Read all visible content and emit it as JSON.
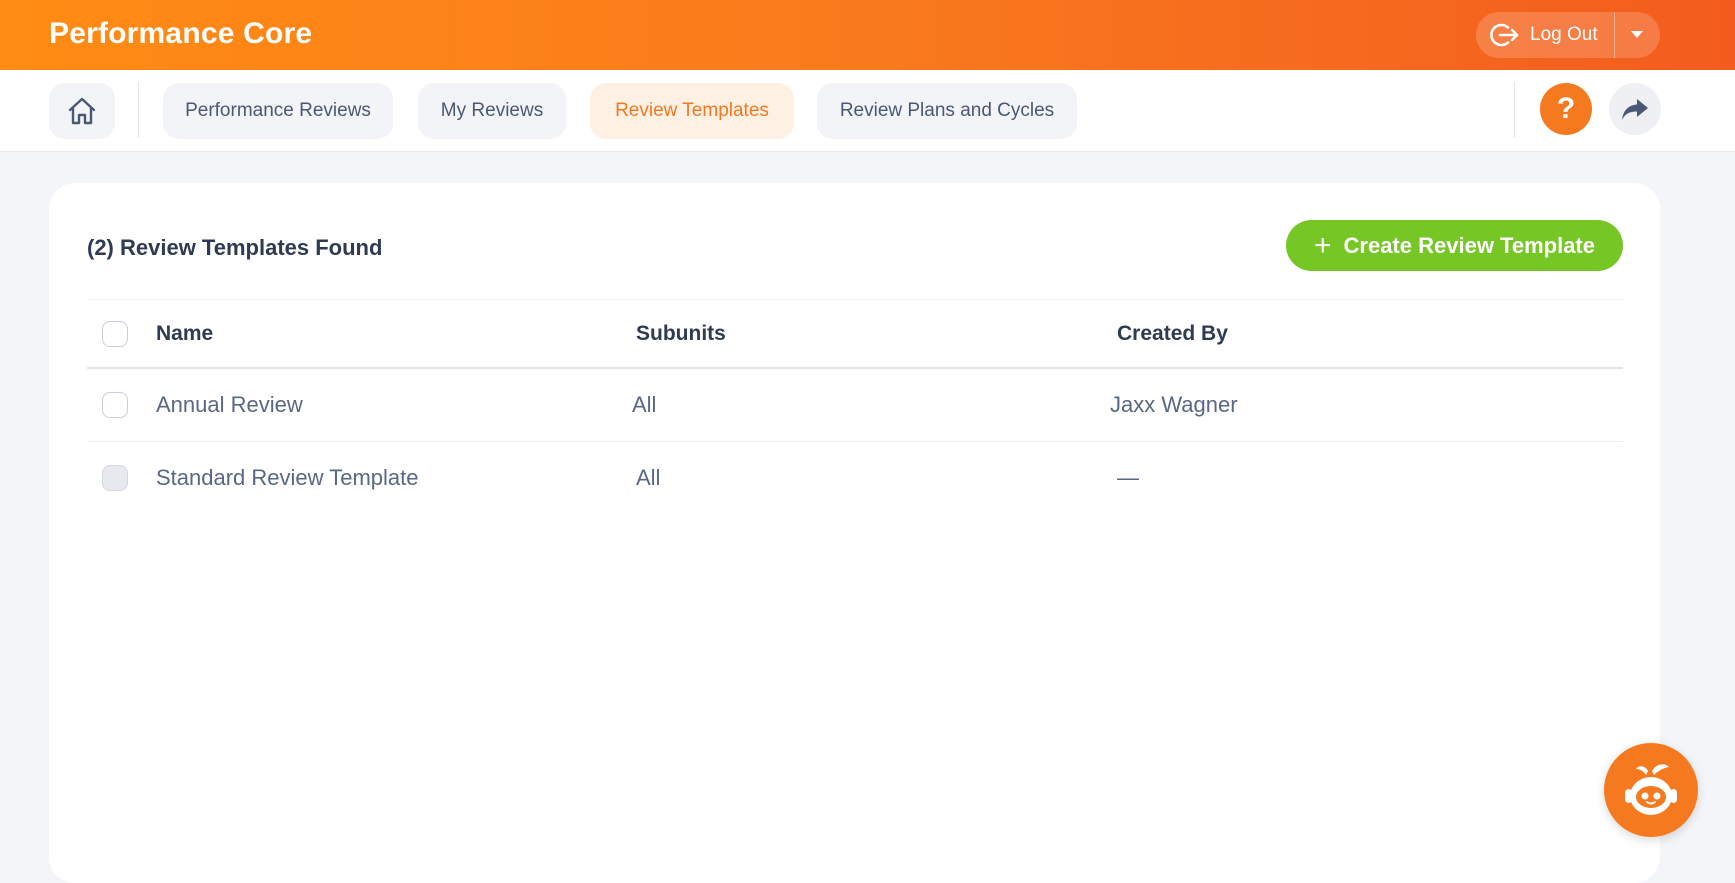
{
  "app": {
    "title": "Performance Core"
  },
  "header": {
    "logout_label": "Log Out",
    "logout_icon": "logout-icon",
    "dropdown_icon": "caret-down-icon"
  },
  "nav": {
    "home_icon": "home-icon",
    "tabs": [
      {
        "label": "Performance Reviews",
        "active": false
      },
      {
        "label": "My Reviews",
        "active": false
      },
      {
        "label": "Review Templates",
        "active": true
      },
      {
        "label": "Review Plans and Cycles",
        "active": false
      }
    ],
    "help_label": "?",
    "share_icon": "share-icon"
  },
  "main": {
    "count_label": "(2) Review Templates Found",
    "create_button": {
      "icon": "+",
      "label": "Create Review Template"
    },
    "table": {
      "columns": [
        "Name",
        "Subunits",
        "Created By"
      ],
      "rows": [
        {
          "name": "Annual Review",
          "subunits": "All",
          "created_by": "Jaxx Wagner",
          "selectable": true
        },
        {
          "name": "Standard Review Template",
          "subunits": "All",
          "created_by": "—",
          "selectable": false
        }
      ]
    }
  },
  "assistant": {
    "icon": "robot-assistant-icon"
  },
  "colors": {
    "brand_orange": "#f57a1f",
    "create_green": "#76c725",
    "active_tab_bg": "#fff0e4"
  }
}
